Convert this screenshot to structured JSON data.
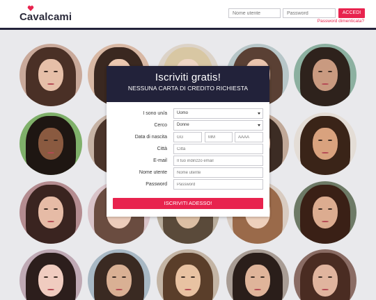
{
  "header": {
    "logo_text": "Cavalcami",
    "username_placeholder": "Nome utente",
    "password_placeholder": "Password",
    "login_button": "ACCEDI",
    "forgot_password": "Password dimenticata?"
  },
  "signup": {
    "title": "Iscriviti gratis!",
    "subtitle": "NESSUNA CARTA DI CREDITO RICHIESTA",
    "fields": {
      "i_am": {
        "label": "I sono un/a",
        "value": "Uomo"
      },
      "seeking": {
        "label": "Cerco",
        "value": "Donne"
      },
      "birthdate": {
        "label": "Data di nascita",
        "day": "GG",
        "month": "MM",
        "year": "AAAA"
      },
      "city": {
        "label": "Città",
        "placeholder": "Città"
      },
      "email": {
        "label": "E-mail",
        "placeholder": "Il tuo indirizzo email"
      },
      "username": {
        "label": "Nome utente",
        "placeholder": "Nome utente"
      },
      "password": {
        "label": "Password",
        "placeholder": "Password"
      }
    },
    "submit_label": "ISCRIVITI ADESSO!"
  },
  "colors": {
    "accent": "#e8234e",
    "dark": "#22223a",
    "page_bg": "#e9e9ec"
  }
}
